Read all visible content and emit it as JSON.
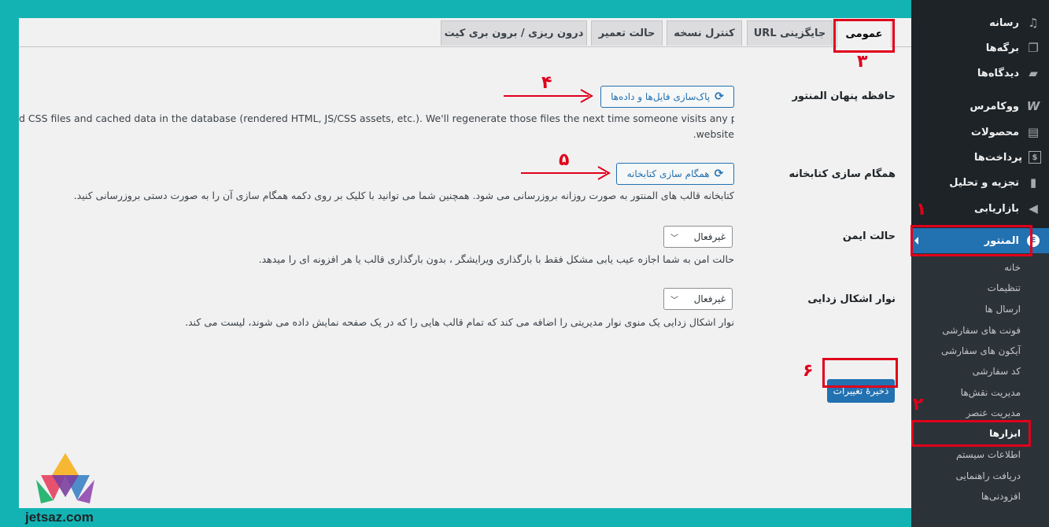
{
  "tabs": [
    {
      "label": "عمومی",
      "active": true
    },
    {
      "label": "جایگزینی URL"
    },
    {
      "label": "کنترل نسخه"
    },
    {
      "label": "حالت تعمیر"
    },
    {
      "label": "درون ریزی / برون بری کیت"
    }
  ],
  "settings": {
    "cache": {
      "label": "حافظه پنهان المنتور",
      "button": "پاک‌سازی فایل‌ها و داده‌ها",
      "desc_line1": "d CSS files and cached data in the database (rendered HTML, JS/CSS assets, etc.). We'll regenerate those files the next time someone visits any page on your",
      "desc_line2": ".website"
    },
    "library": {
      "label": "همگام سازی کتابخانه",
      "button": "همگام سازی کتابخانه",
      "desc": "کتابخانه قالب های المنتور به صورت روزانه بروزرسانی می شود. همچنین شما می توانید با کلیک بر روی دکمه همگام سازی آن را به صورت دستی بروزرسانی کنید."
    },
    "safe_mode": {
      "label": "حالت ایمن",
      "value": "غیرفعال",
      "desc": "حالت امن به شما اجازه عیب یابی مشکل فقط با بارگذاری ویرایشگر ، بدون بارگذاری قالب یا هر افزونه ای را میدهد."
    },
    "debug_bar": {
      "label": "نوار اشکال زدایی",
      "value": "غیرفعال",
      "desc": "نوار اشکال زدایی یک منوی نوار مدیریتی را اضافه می کند که تمام قالب هایی را که در یک صفحه نمایش داده می شوند، لیست می کند."
    },
    "save_button": "ذخیرهٔ تغییرات"
  },
  "sidebar": {
    "menu": [
      {
        "label": "رسانه",
        "icon": "media-icon"
      },
      {
        "label": "برگه‌ها",
        "icon": "pages-icon"
      },
      {
        "label": "دیدگاه‌ها",
        "icon": "comments-icon"
      },
      {
        "label": "ووکامرس",
        "icon": "woocommerce-icon"
      },
      {
        "label": "محصولات",
        "icon": "products-icon"
      },
      {
        "label": "پرداخت‌ها",
        "icon": "payments-icon"
      },
      {
        "label": "تجزیه و تحلیل",
        "icon": "analytics-icon"
      },
      {
        "label": "بازاریابی",
        "icon": "marketing-icon"
      }
    ],
    "elementor": {
      "label": "المنتور",
      "icon": "elementor-icon"
    },
    "submenu": [
      "خانه",
      "تنظیمات",
      "ارسال ها",
      "فونت های سفارشی",
      "آیکون های سفارشی",
      "کد سفارشی",
      "مدیریت نقش‌ها",
      "مدیریت عنصر",
      "ابزارها",
      "اطلاعات سیستم",
      "دریافت راهنمایی",
      "افزودنی‌ها"
    ]
  },
  "annotations": [
    "۱",
    "۲",
    "۳",
    "۴",
    "۵",
    "۶"
  ],
  "watermark": "jetsaz.com",
  "colors": {
    "accent": "#2271b1",
    "sidebar": "#1d2327",
    "highlight": "#e0001b",
    "frame": "#13b3b3"
  }
}
